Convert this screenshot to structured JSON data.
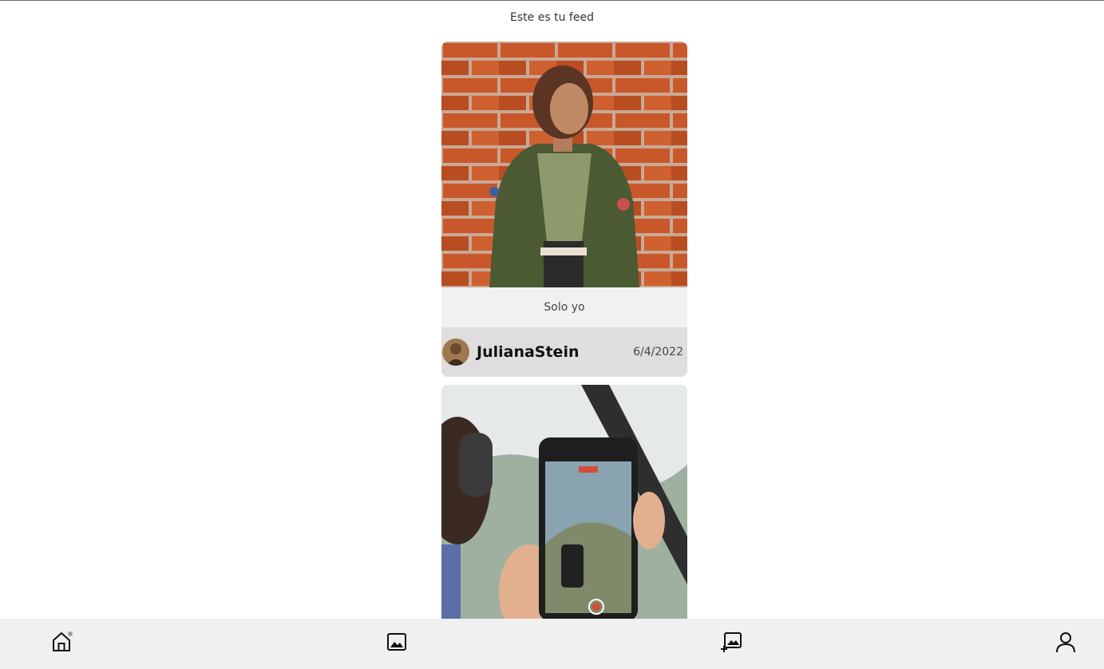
{
  "feed": {
    "title": "Este es tu feed"
  },
  "posts": [
    {
      "caption": "Solo yo",
      "username": "JulianaStein",
      "date": "6/4/2022"
    },
    {
      "caption": "",
      "username": "",
      "date": ""
    }
  ],
  "nav": {
    "items": [
      "home-icon",
      "image-icon",
      "add-image-icon",
      "user-icon"
    ]
  },
  "colors": {
    "nav_background": "#f0f0f0",
    "caption_background": "#f1f1f1",
    "author_background": "#dedede",
    "text_dark": "#111111"
  }
}
